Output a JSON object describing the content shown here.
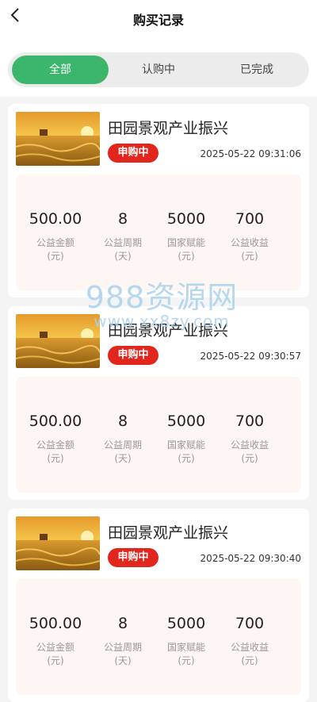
{
  "header": {
    "title": "购买记录",
    "back_icon": "chevron-left-icon"
  },
  "tabs": [
    {
      "label": "全部",
      "active": true
    },
    {
      "label": "认购中",
      "active": false
    },
    {
      "label": "已完成",
      "active": false
    }
  ],
  "colors": {
    "accent": "#3bb66c",
    "status_badge": "#e1261d",
    "stats_background": "#fdf6f2",
    "watermark": "#a9d2ee"
  },
  "records": [
    {
      "title": "田园景观产业振兴",
      "status": "申购中",
      "time": "2025-05-22 09:31:06",
      "stats": [
        {
          "value": "500.00",
          "label": "公益金额(元)"
        },
        {
          "value": "8",
          "label": "公益周期(天)"
        },
        {
          "value": "5000",
          "label": "国家赋能(元)"
        },
        {
          "value": "700",
          "label": "公益收益(元)"
        }
      ]
    },
    {
      "title": "田园景观产业振兴",
      "status": "申购中",
      "time": "2025-05-22 09:30:57",
      "stats": [
        {
          "value": "500.00",
          "label": "公益金额(元)"
        },
        {
          "value": "8",
          "label": "公益周期(天)"
        },
        {
          "value": "5000",
          "label": "国家赋能(元)"
        },
        {
          "value": "700",
          "label": "公益收益(元)"
        }
      ]
    },
    {
      "title": "田园景观产业振兴",
      "status": "申购中",
      "time": "2025-05-22 09:30:40",
      "stats": [
        {
          "value": "500.00",
          "label": "公益金额(元)"
        },
        {
          "value": "8",
          "label": "公益周期(天)"
        },
        {
          "value": "5000",
          "label": "国家赋能(元)"
        },
        {
          "value": "700",
          "label": "公益收益(元)"
        }
      ]
    }
  ],
  "watermark": {
    "main": "988资源网",
    "sub": "www.xx8zy.com"
  }
}
